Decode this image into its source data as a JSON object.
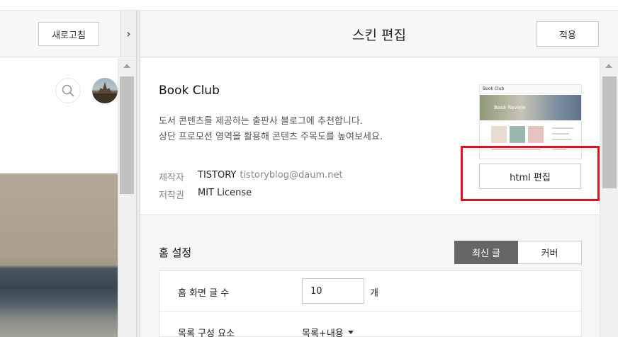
{
  "left": {
    "refresh_label": "새로고침",
    "expand_icon": "chevron-right-icon",
    "search_icon": "search-icon"
  },
  "editor": {
    "title": "스킨 편집",
    "apply_label": "적용"
  },
  "skin": {
    "name": "Book Club",
    "description_line1": "도서 콘텐츠를 제공하는 출판사 블로그에 추천합니다.",
    "description_line2": "상단 프로모션 영역을 활용해 콘텐츠 주목도를 높여보세요.",
    "author_label": "제작자",
    "author_name": "TISTORY",
    "author_email": "tistoryblog@daum.net",
    "license_label": "저작권",
    "license_value": "MIT License",
    "html_edit_label": "html 편집",
    "thumbnail": {
      "logo_text": "Book Club",
      "hero_text": "Book Review"
    },
    "highlight_color": "#e0121c"
  },
  "home_settings": {
    "title": "홈 설정",
    "tabs": [
      {
        "label": "최신 글",
        "active": true
      },
      {
        "label": "커버",
        "active": false
      }
    ],
    "post_count_label": "홈 화면 글 수",
    "post_count_value": "10",
    "post_count_unit": "개",
    "list_components_label": "목록 구성 요소",
    "list_components_value": "목록+내용"
  }
}
